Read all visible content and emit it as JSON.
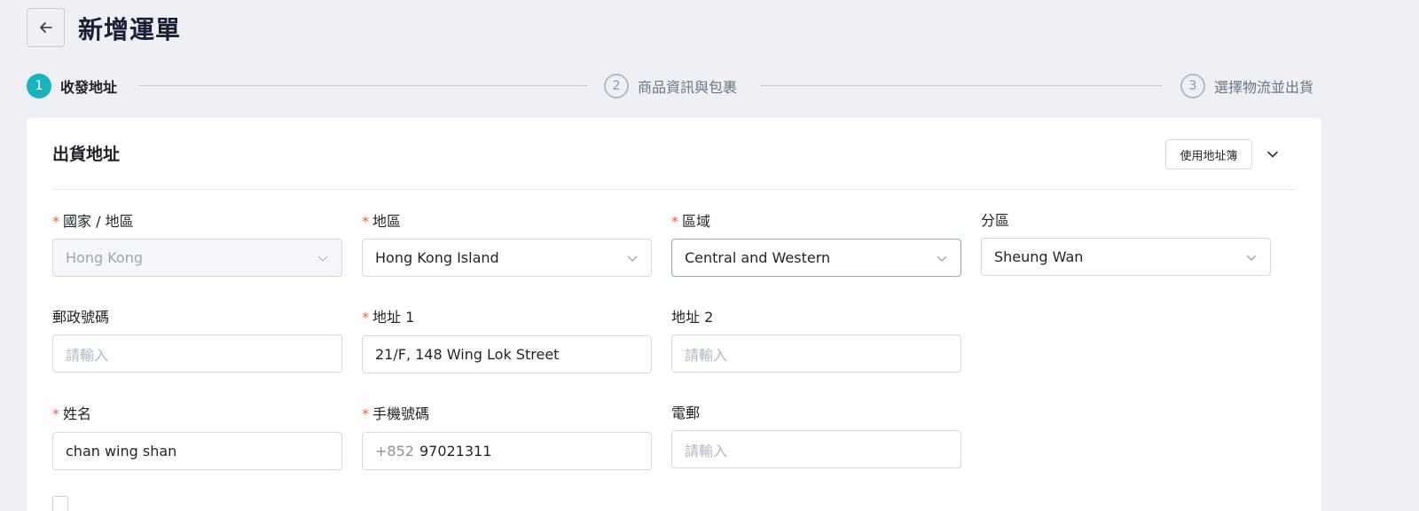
{
  "header": {
    "back_icon": "arrow-left-icon",
    "title": "新增運單"
  },
  "steps": [
    {
      "number": "1",
      "label": "收發地址",
      "state": "active"
    },
    {
      "number": "2",
      "label": "商品資訊與包裹",
      "state": "inactive"
    },
    {
      "number": "3",
      "label": "選擇物流並出貨",
      "state": "inactive"
    }
  ],
  "section": {
    "title": "出貨地址",
    "address_book_label": "使用地址簿",
    "collapse_icon": "chevron-down-icon"
  },
  "form": {
    "required_mark": "*",
    "country": {
      "label": "國家 / 地區",
      "value": "Hong Kong"
    },
    "region": {
      "label": "地區",
      "value": "Hong Kong Island"
    },
    "district": {
      "label": "區域",
      "value": "Central and Western"
    },
    "subdistrict": {
      "label": "分區",
      "value": "Sheung Wan"
    },
    "postal_code": {
      "label": "郵政號碼",
      "placeholder": "請輸入"
    },
    "address1": {
      "label": "地址 1",
      "value": "21/F, 148 Wing Lok Street"
    },
    "address2": {
      "label": "地址 2",
      "placeholder": "請輸入"
    },
    "name": {
      "label": "姓名",
      "value": "chan wing shan"
    },
    "phone": {
      "label": "手機號碼",
      "prefix": "+852",
      "value": "97021311"
    },
    "email": {
      "label": "電郵",
      "placeholder": "請輸入"
    }
  },
  "colors": {
    "accent": "#17b4bf",
    "required": "#f0643a",
    "background": "#eef0f6"
  }
}
